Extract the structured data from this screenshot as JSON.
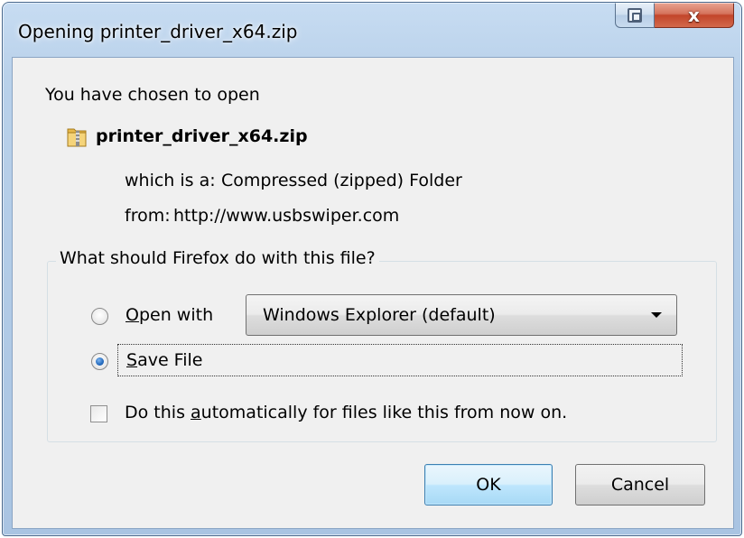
{
  "window": {
    "title": "Opening printer_driver_x64.zip",
    "close_glyph": "x"
  },
  "dialog": {
    "heading": "You have chosen to open",
    "file_icon": "zip-folder-icon",
    "filename": "printer_driver_x64.zip",
    "which_is_label": "which is a:",
    "which_is_value": "Compressed (zipped) Folder",
    "from_label": "from:",
    "from_value": "http://www.usbswiper.com",
    "group_label": "What should Firefox do with this file?",
    "open_with": {
      "mnemonic": "O",
      "rest": "pen with",
      "selected": false
    },
    "app_select": {
      "value": "Windows Explorer (default)"
    },
    "save_file": {
      "mnemonic": "S",
      "rest": "ave File",
      "selected": true
    },
    "auto_checkbox": {
      "before": "Do this ",
      "mnemonic": "a",
      "after": "utomatically for files like this from now on.",
      "checked": false
    },
    "buttons": {
      "ok": "OK",
      "cancel": "Cancel"
    }
  },
  "colors": {
    "frame": "#b9d1ea",
    "client": "#f0f0f0",
    "close_button": "#c2452a",
    "ok_border": "#3c7fb1"
  }
}
